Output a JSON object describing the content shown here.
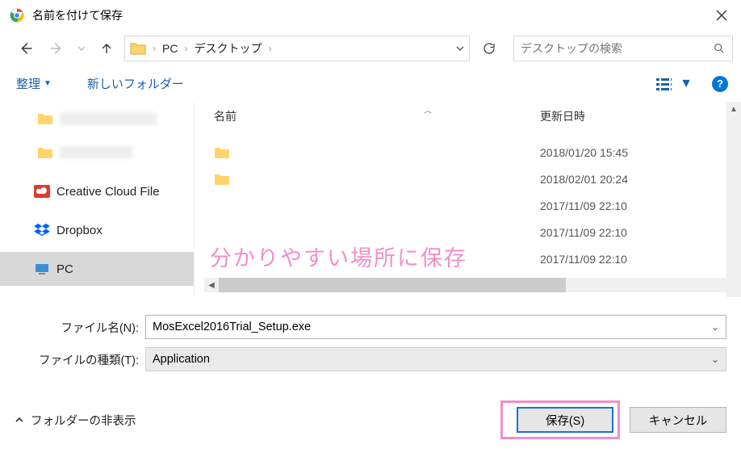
{
  "window": {
    "title": "名前を付けて保存"
  },
  "nav": {
    "crumbs": [
      "PC",
      "デスクトップ"
    ],
    "search_placeholder": "デスクトップの検索"
  },
  "toolbar": {
    "organize": "整理",
    "new_folder": "新しいフォルダー"
  },
  "columns": {
    "name": "名前",
    "date": "更新日時"
  },
  "files": [
    {
      "date": "2018/01/20 15:45"
    },
    {
      "date": "2018/02/01 20:24"
    },
    {
      "date": "2017/11/09 22:10"
    },
    {
      "date": "2017/11/09 22:10"
    },
    {
      "date": "2017/11/09 22:10"
    }
  ],
  "sidebar": {
    "items": [
      {
        "label": "Creative Cloud File",
        "icon": "cc"
      },
      {
        "label": "Dropbox",
        "icon": "dropbox"
      },
      {
        "label": "PC",
        "icon": "pc"
      }
    ]
  },
  "annotation": "分かりやすい場所に保存",
  "fields": {
    "filename_label": "ファイル名(N):",
    "filename_value": "MosExcel2016Trial_Setup.exe",
    "filetype_label": "ファイルの種類(T):",
    "filetype_value": "Application"
  },
  "footer": {
    "hide_folders": "フォルダーの非表示",
    "save": "保存(S)",
    "cancel": "キャンセル"
  }
}
